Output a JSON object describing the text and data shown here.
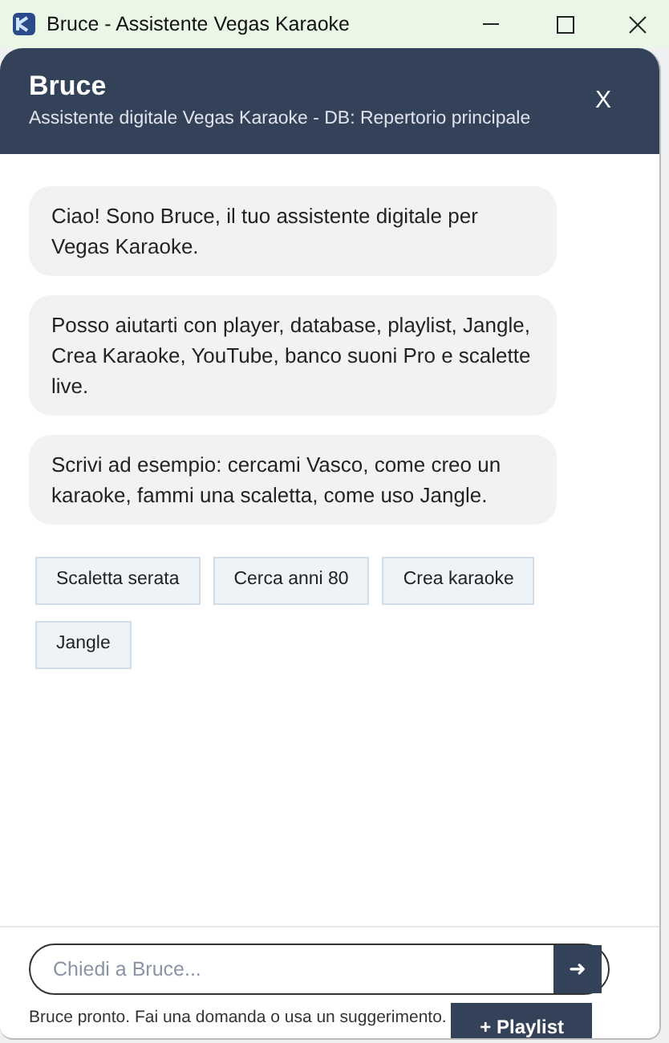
{
  "window": {
    "title": "Bruce - Assistente Vegas Karaoke"
  },
  "header": {
    "title": "Bruce",
    "subtitle": "Assistente digitale Vegas Karaoke - DB: Repertorio principale",
    "close": "X"
  },
  "messages": [
    {
      "text": "Ciao! Sono Bruce, il tuo assistente digitale per Vegas Karaoke."
    },
    {
      "text": "Posso aiutarti con player, database, playlist, Jangle, Crea Karaoke, YouTube, banco suoni Pro e scalette live."
    },
    {
      "text": "Scrivi ad esempio: cercami Vasco, come creo un karaoke, fammi una scaletta, come uso Jangle."
    }
  ],
  "suggestions": [
    "Scaletta serata",
    "Cerca anni 80",
    "Crea karaoke",
    "Jangle"
  ],
  "input": {
    "placeholder": "Chiedi a Bruce...",
    "send": "➜"
  },
  "status": "Bruce pronto. Fai una domanda o usa un suggerimento.",
  "playlist_button": "+ Playlist"
}
